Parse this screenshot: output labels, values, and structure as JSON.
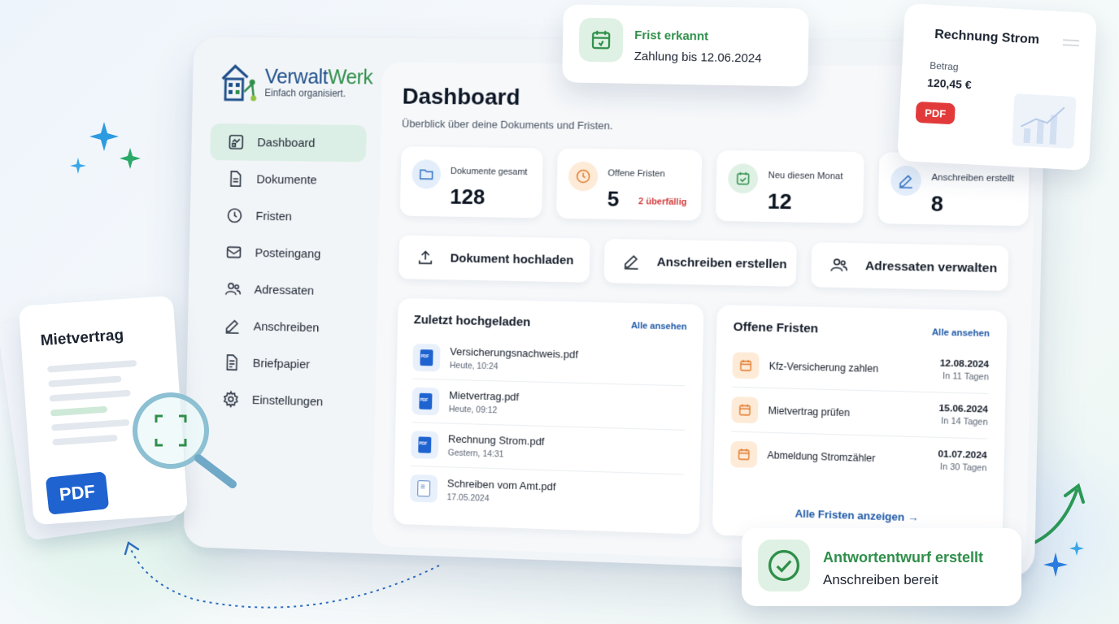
{
  "app": {
    "logo_name_a": "Verwalt",
    "logo_name_b": "Werk",
    "logo_tagline": "Einfach organisiert."
  },
  "sidebar": {
    "items": [
      {
        "label": "Dashboard",
        "icon": "dashboard-icon",
        "active": true
      },
      {
        "label": "Dokumente",
        "icon": "document-icon"
      },
      {
        "label": "Fristen",
        "icon": "clock-icon"
      },
      {
        "label": "Posteingang",
        "icon": "inbox-icon"
      },
      {
        "label": "Adressaten",
        "icon": "users-icon"
      },
      {
        "label": "Anschreiben",
        "icon": "pen-icon"
      },
      {
        "label": "Briefpapier",
        "icon": "letterhead-icon"
      },
      {
        "label": "Einstellungen",
        "icon": "gear-icon"
      }
    ]
  },
  "header": {
    "title": "Dashboard",
    "subtitle": "Überblick über deine Dokuments und Fristen."
  },
  "stats": [
    {
      "label": "Dokumente gesamt",
      "value": "128",
      "icon": "folder-icon"
    },
    {
      "label": "Offene Fristen",
      "value": "5",
      "warning": "2 überfällig",
      "icon": "clock-icon"
    },
    {
      "label": "Neu diesen Monat",
      "value": "12",
      "icon": "calendar-check-icon"
    },
    {
      "label": "Anschreiben erstellt",
      "value": "8",
      "icon": "pen-icon"
    }
  ],
  "actions": [
    {
      "label": "Dokument hochladen",
      "icon": "upload-icon"
    },
    {
      "label": "Anschreiben erstellen",
      "icon": "pen-icon"
    },
    {
      "label": "Adressaten verwalten",
      "icon": "users-icon"
    }
  ],
  "recent": {
    "title": "Zuletzt hochgeladen",
    "link": "Alle ansehen",
    "files": [
      {
        "name": "Versicherungsnachweis.pdf",
        "date": "Heute, 10:24",
        "icon": "pdf-icon"
      },
      {
        "name": "Mietvertrag.pdf",
        "date": "Heute, 09:12",
        "icon": "pdf-icon"
      },
      {
        "name": "Rechnung Strom.pdf",
        "date": "Gestern, 14:31",
        "icon": "pdf-icon"
      },
      {
        "name": "Schreiben vom Amt.pdf",
        "date": "17.05.2024",
        "icon": "document-icon"
      }
    ]
  },
  "deadlines": {
    "title": "Offene Fristen",
    "link": "Alle ansehen",
    "items": [
      {
        "name": "Kfz-Versicherung zahlen",
        "date": "12.08.2024",
        "rel": "In 11 Tagen"
      },
      {
        "name": "Mietvertrag prüfen",
        "date": "15.06.2024",
        "rel": "In 14 Tagen"
      },
      {
        "name": "Abmeldung Stromzähler",
        "date": "01.07.2024",
        "rel": "In 30 Tagen"
      }
    ],
    "all_label": "Alle Fristen anzeigen"
  },
  "toast_top": {
    "title": "Frist erkannt",
    "text": "Zahlung bis 12.06.2024"
  },
  "invoice_card": {
    "title": "Rechnung Strom",
    "amount_label": "Betrag",
    "amount": "120,45 €",
    "badge": "PDF"
  },
  "contract_card": {
    "title": "Mietvertrag",
    "badge": "PDF"
  },
  "toast_bottom": {
    "title": "Antwortentwurf erstellt",
    "text": "Anschreiben bereit"
  },
  "colors": {
    "accent_green": "#2f8f4a",
    "accent_blue": "#1f5aa8",
    "warning_red": "#d33b3b",
    "deadline_orange": "#e07a2c"
  }
}
